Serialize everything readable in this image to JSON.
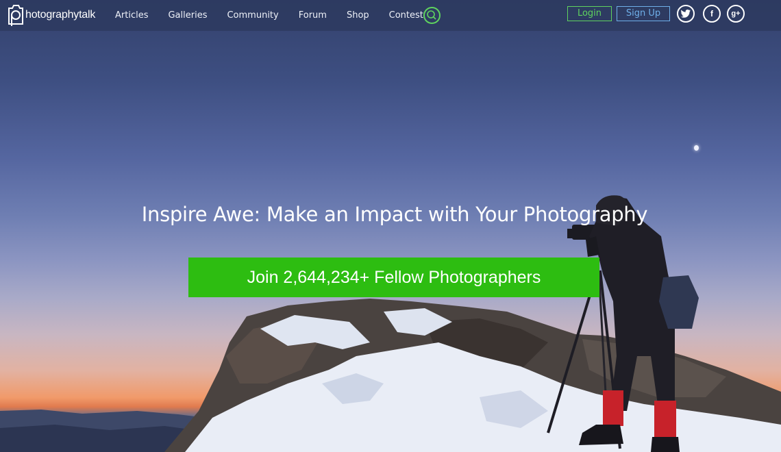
{
  "brand": {
    "logo_text": "hotographytalk"
  },
  "nav": {
    "items": [
      {
        "label": "Articles"
      },
      {
        "label": "Galleries"
      },
      {
        "label": "Community"
      },
      {
        "label": "Forum"
      },
      {
        "label": "Shop"
      },
      {
        "label": "Contest"
      }
    ],
    "search_icon": "search-icon",
    "login_label": "Login",
    "signup_label": "Sign Up",
    "social": [
      {
        "icon": "twitter-icon",
        "glyph": "t"
      },
      {
        "icon": "facebook-icon",
        "glyph": "f"
      },
      {
        "icon": "googleplus-icon",
        "glyph": "g+"
      }
    ]
  },
  "hero": {
    "headline": "Inspire Awe: Make an Impact with Your Photography",
    "cta_label": "Join 2,644,234+ Fellow Photographers"
  },
  "colors": {
    "accent_green": "#2dbd11",
    "login_green": "#5fd35f",
    "signup_blue": "#6fb0ea",
    "nav_bg": "#2d3a5f"
  }
}
